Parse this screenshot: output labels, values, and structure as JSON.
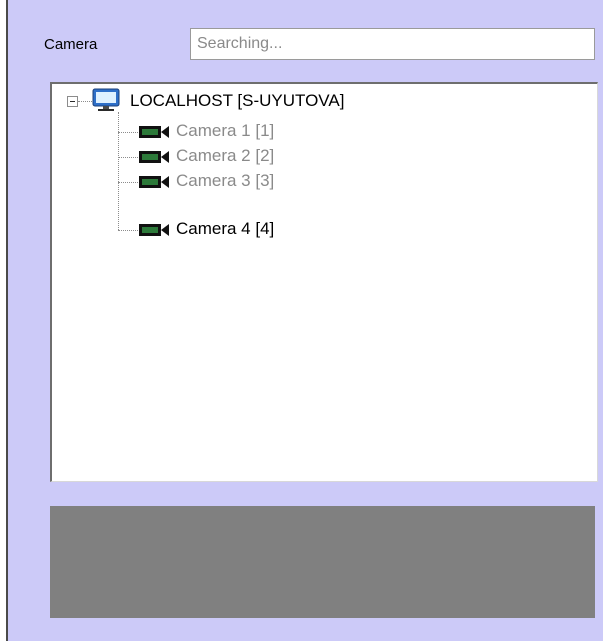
{
  "camera_label": "Camera",
  "search": {
    "placeholder": "Searching..."
  },
  "tree": {
    "host": {
      "label": "LOCALHOST [S-UYUTOVA]",
      "icon": "monitor-icon"
    },
    "cameras": [
      {
        "label": "Camera 1 [1]",
        "state": "disabled",
        "icon": "camera-icon"
      },
      {
        "label": "Camera 2 [2]",
        "state": "disabled",
        "icon": "camera-icon"
      },
      {
        "label": "Camera 3 [3]",
        "state": "disabled",
        "icon": "camera-icon"
      },
      {
        "label": "Camera 4 [4]",
        "state": "active",
        "icon": "camera-icon"
      }
    ]
  },
  "colors": {
    "panel_background": "#cccaf8",
    "preview_area": "#808080",
    "disabled_text": "#8a8a8a"
  }
}
